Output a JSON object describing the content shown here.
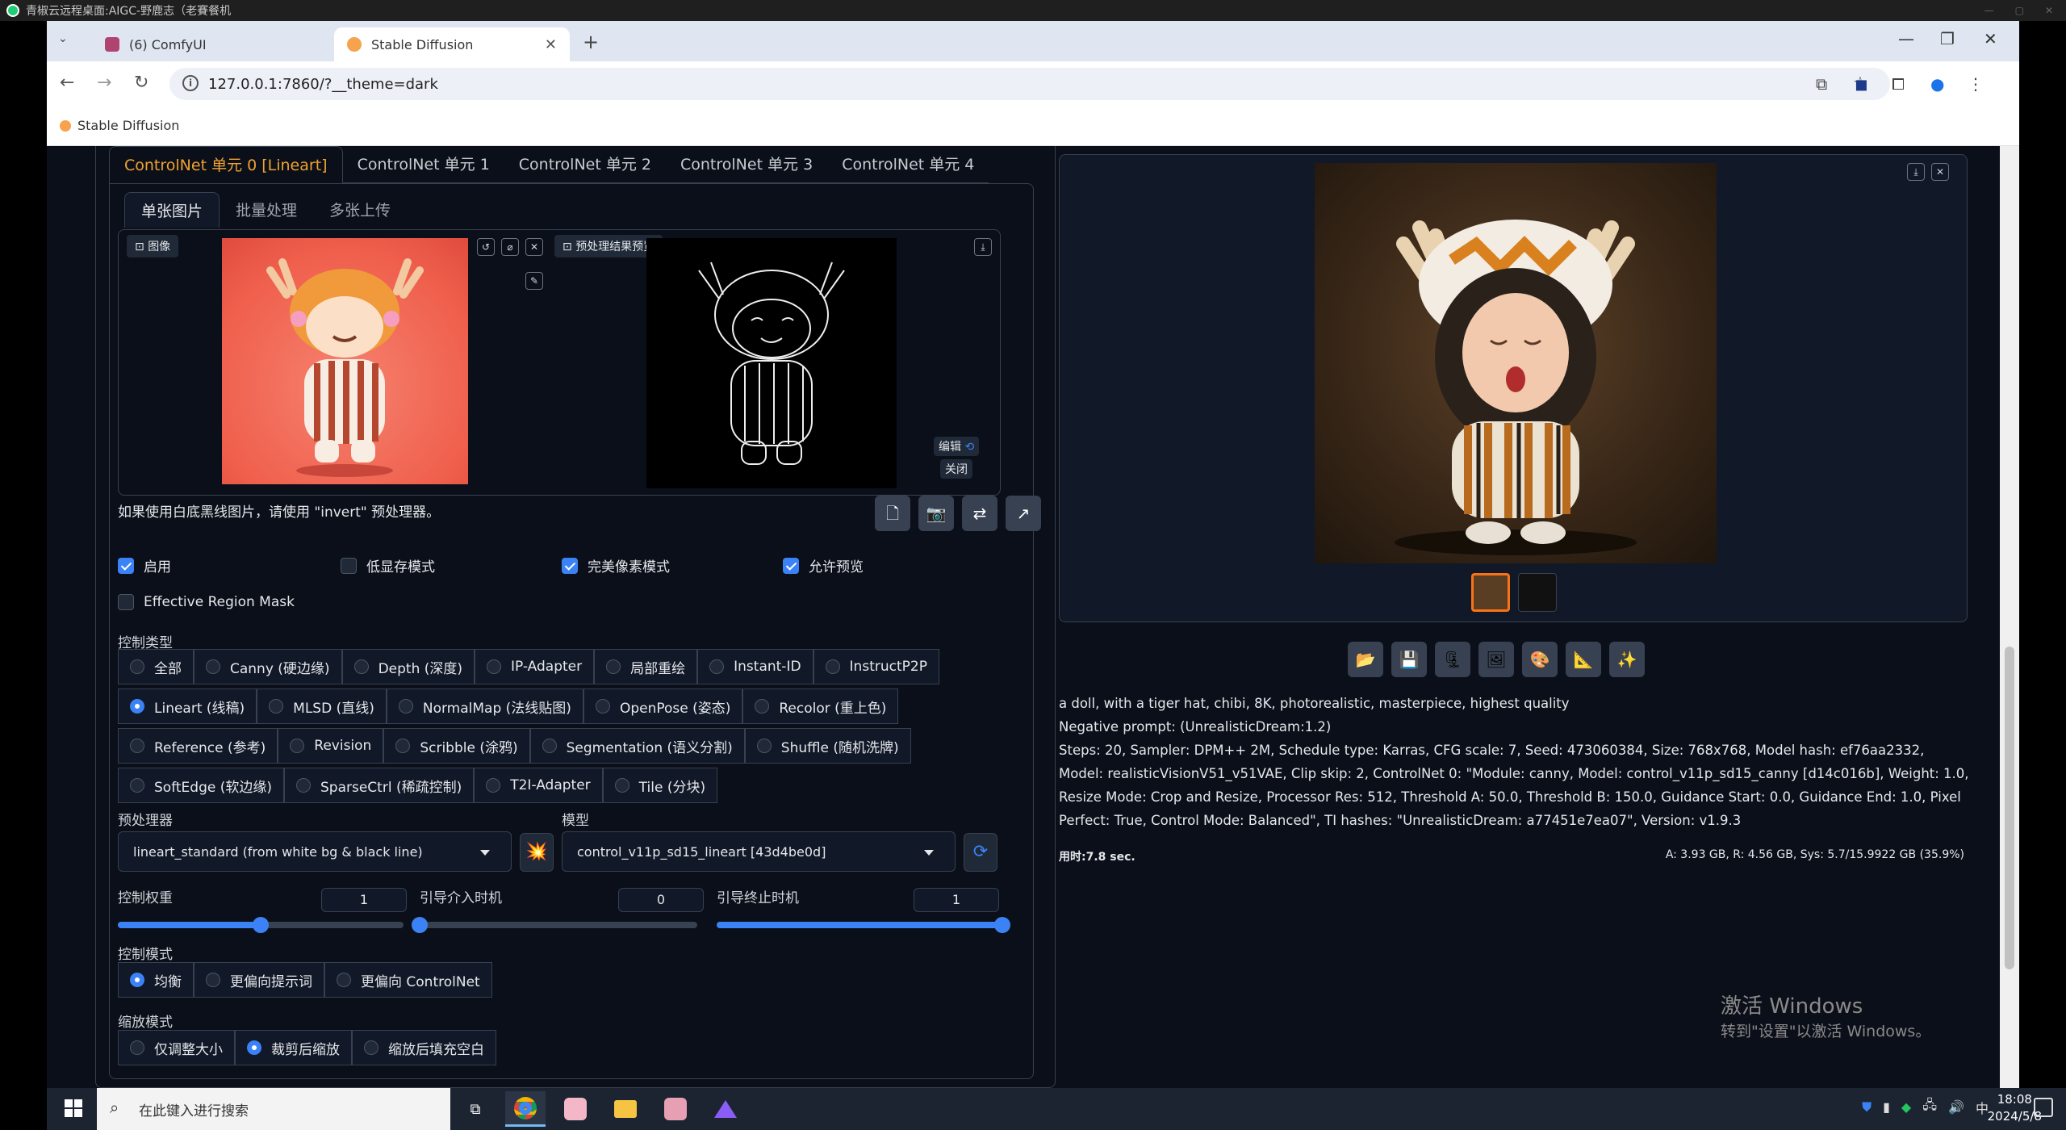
{
  "remote": {
    "title": "青椒云远程桌面:AIGC-野鹿志（老賽餐机"
  },
  "browser": {
    "tabs": [
      {
        "label": "(6) ComfyUI",
        "active": false
      },
      {
        "label": "Stable Diffusion",
        "active": true
      }
    ],
    "url": "127.0.0.1:7860/?__theme=dark",
    "bookmark": "Stable Diffusion"
  },
  "controlnet": {
    "unit_tabs": [
      "ControlNet 单元 0 [Lineart]",
      "ControlNet 单元 1",
      "ControlNet 单元 2",
      "ControlNet 单元 3",
      "ControlNet 单元 4"
    ],
    "sub_tabs": [
      "单张图片",
      "批量处理",
      "多张上传"
    ],
    "image_label": "图像",
    "preview_label": "预处理结果预览",
    "edit_label": "编辑",
    "close_label": "关闭",
    "hint": "如果使用白底黑线图片，请使用 \"invert\" 预处理器。",
    "checkboxes": [
      {
        "label": "启用",
        "checked": true
      },
      {
        "label": "低显存模式",
        "checked": false
      },
      {
        "label": "完美像素模式",
        "checked": true
      },
      {
        "label": "允许预览",
        "checked": true
      }
    ],
    "region_mask": {
      "label": "Effective Region Mask",
      "checked": false
    },
    "control_type_label": "控制类型",
    "control_types": [
      [
        "全部",
        "Canny (硬边缘)",
        "Depth (深度)",
        "IP-Adapter",
        "局部重绘",
        "Instant-ID",
        "InstructP2P"
      ],
      [
        "Lineart (线稿)",
        "MLSD (直线)",
        "NormalMap (法线贴图)",
        "OpenPose (姿态)",
        "Recolor (重上色)"
      ],
      [
        "Reference (参考)",
        "Revision",
        "Scribble (涂鸦)",
        "Segmentation (语义分割)",
        "Shuffle (随机洗牌)"
      ],
      [
        "SoftEdge (软边缘)",
        "SparseCtrl (稀疏控制)",
        "T2I-Adapter",
        "Tile (分块)"
      ]
    ],
    "selected_type": "Lineart (线稿)",
    "preprocessor_label": "预处理器",
    "preprocessor": "lineart_standard (from white bg & black line)",
    "model_label": "模型",
    "model": "control_v11p_sd15_lineart [43d4be0d]",
    "weight_label": "控制权重",
    "weight": "1",
    "start_label": "引导介入时机",
    "start": "0",
    "end_label": "引导终止时机",
    "end": "1",
    "sliders": {
      "weight_frac": 0.5,
      "start_frac": 0.0,
      "end_frac": 1.0
    },
    "mode_label": "控制模式",
    "modes": [
      "均衡",
      "更偏向提示词",
      "更偏向 ControlNet"
    ],
    "selected_mode": "均衡",
    "resize_label": "缩放模式",
    "resize_modes": [
      "仅调整大小",
      "裁剪后缩放",
      "缩放后填充空白"
    ],
    "selected_resize": "裁剪后缩放"
  },
  "output": {
    "prompt": "a doll, with a tiger hat, chibi, 8K, photorealistic, masterpiece, highest quality",
    "negative": "Negative prompt: (UnrealisticDream:1.2)",
    "params": "Steps: 20, Sampler: DPM++ 2M, Schedule type: Karras, CFG scale: 7, Seed: 473060384, Size: 768x768, Model hash: ef76aa2332, Model: realisticVisionV51_v51VAE, Clip skip: 2, ControlNet 0: \"Module: canny, Model: control_v11p_sd15_canny [d14c016b], Weight: 1.0, Resize Mode: Crop and Resize, Processor Res: 512, Threshold A: 50.0, Threshold B: 150.0, Guidance Start: 0.0, Guidance End: 1.0, Pixel Perfect: True, Control Mode: Balanced\", TI hashes: \"UnrealisticDream: a77451e7ea07\", Version: v1.9.3",
    "timing": "用时:7.8 sec.",
    "memory": "A: 3.93 GB, R: 4.56 GB, Sys: 5.7/15.9922 GB (35.9%)"
  },
  "windows_activation": {
    "line1": "激活 Windows",
    "line2": "转到\"设置\"以激活 Windows。"
  },
  "taskbar": {
    "search_placeholder": "在此键入进行搜索",
    "ime": "中",
    "time": "18:08",
    "date": "2024/5/8"
  },
  "colors": {
    "accent": "#3b82f6",
    "tab_active": "#f0a22f",
    "bg": "#0b0f19"
  }
}
